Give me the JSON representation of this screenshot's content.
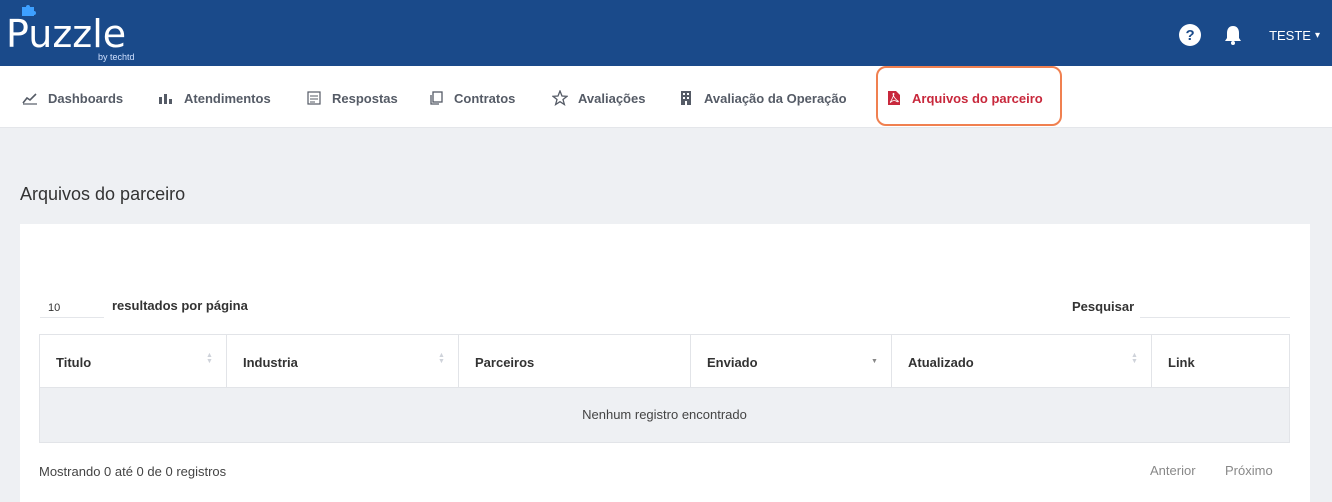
{
  "brand": {
    "name": "Puzzle",
    "tagline": "by techtd"
  },
  "header": {
    "help_glyph": "?",
    "user_label": "TESTE",
    "chevron": "⌄"
  },
  "nav": {
    "items": [
      {
        "label": "Dashboards",
        "icon": "chart-line-icon"
      },
      {
        "label": "Atendimentos",
        "icon": "bar-chart-icon"
      },
      {
        "label": "Respostas",
        "icon": "form-icon"
      },
      {
        "label": "Contratos",
        "icon": "copy-icon"
      },
      {
        "label": "Avaliações",
        "icon": "star-icon"
      },
      {
        "label": "Avaliação da Operação",
        "icon": "building-icon"
      },
      {
        "label": "Arquivos do parceiro",
        "icon": "pdf-icon",
        "active": true
      }
    ]
  },
  "page": {
    "title": "Arquivos do parceiro"
  },
  "table": {
    "length_value": "10",
    "length_label": "resultados por página",
    "search_label": "Pesquisar",
    "search_value": "",
    "columns": [
      "Titulo",
      "Industria",
      "Parceiros",
      "Enviado",
      "Atualizado",
      "Link"
    ],
    "empty_message": "Nenhum registro encontrado",
    "info": "Mostrando 0 até 0 de 0 registros",
    "prev_label": "Anterior",
    "next_label": "Próximo"
  },
  "colors": {
    "header_bg": "#1a4a8a",
    "active_nav": "#c8283c",
    "highlight_ring": "#f08050",
    "page_bg": "#eef0f3"
  }
}
